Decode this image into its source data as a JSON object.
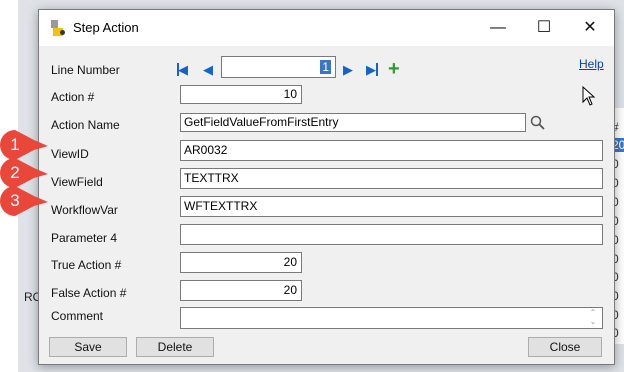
{
  "window": {
    "title": "Step Action"
  },
  "fields": {
    "line_number": {
      "label": "Line Number",
      "value": "1"
    },
    "action_num": {
      "label": "Action #",
      "value": "10"
    },
    "action_name": {
      "label": "Action Name",
      "value": "GetFieldValueFromFirstEntry"
    },
    "view_id": {
      "label": "ViewID",
      "value": "AR0032"
    },
    "view_field": {
      "label": "ViewField",
      "value": "TEXTTRX"
    },
    "workflow_var": {
      "label": "WorkflowVar",
      "value": "WFTEXTTRX"
    },
    "parameter4": {
      "label": "Parameter 4",
      "value": ""
    },
    "true_action": {
      "label": "True Action #",
      "value": "20"
    },
    "false_action": {
      "label": "False Action #",
      "value": "20"
    },
    "comment": {
      "label": "Comment",
      "value": ""
    }
  },
  "help_link": "Help",
  "buttons": {
    "save": "Save",
    "delete": "Delete",
    "close": "Close"
  },
  "callouts": [
    "1",
    "2",
    "3"
  ],
  "background": {
    "left_text": "RO",
    "right_column": [
      "#",
      "20",
      "0",
      "0",
      "0",
      "0",
      "0",
      "0",
      "0",
      "0",
      "0",
      "0"
    ]
  },
  "colors": {
    "callout": "#e8473a",
    "nav_icon": "#1464c8",
    "add_icon": "#2f9b2f",
    "link": "#0645ad"
  },
  "icons": [
    "first-record-icon",
    "previous-record-icon",
    "next-record-icon",
    "last-record-icon",
    "add-icon",
    "search-icon",
    "mouse-pointer-icon"
  ]
}
